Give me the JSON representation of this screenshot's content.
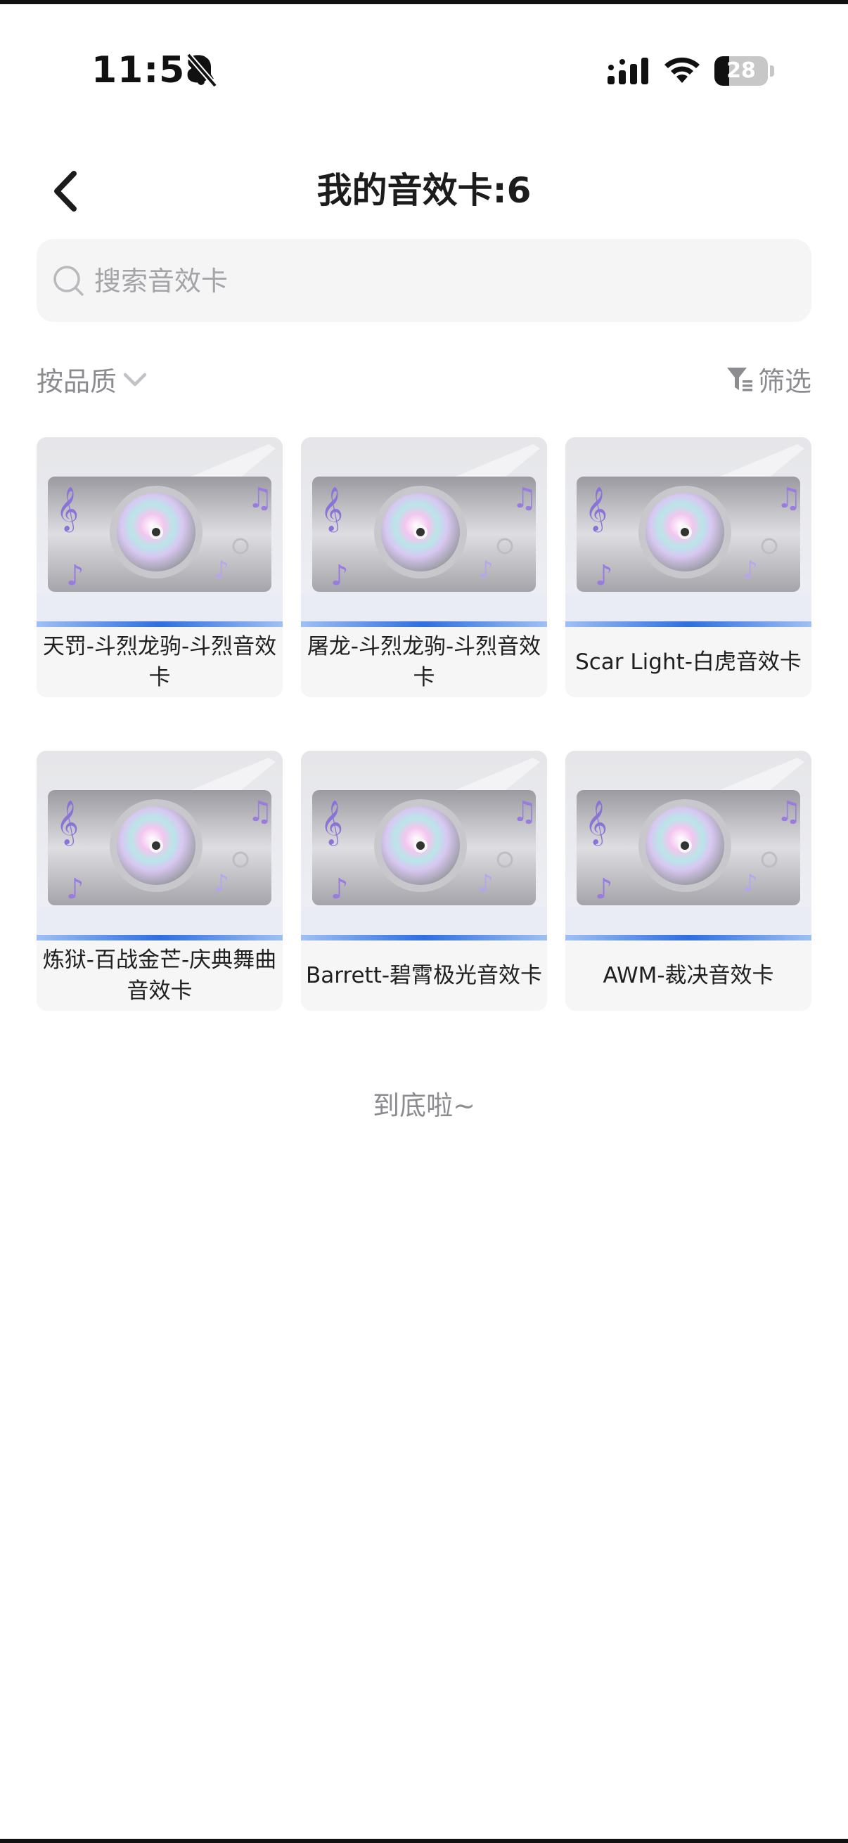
{
  "status_bar": {
    "time": "11:58",
    "battery": "28",
    "battery_level": 0.28
  },
  "header": {
    "title": "我的音效卡:6"
  },
  "search": {
    "placeholder": "搜索音效卡"
  },
  "toolbar": {
    "sort_label": "按品质",
    "filter_label": "筛选"
  },
  "cards": [
    {
      "name": "天罚-斗烈龙驹-斗烈音效卡"
    },
    {
      "name": "屠龙-斗烈龙驹-斗烈音效卡"
    },
    {
      "name": "Scar Light-白虎音效卡"
    },
    {
      "name": "炼狱-百战金芒-庆典舞曲音效卡"
    },
    {
      "name": "Barrett-碧霄极光音效卡"
    },
    {
      "name": "AWM-裁决音效卡"
    }
  ],
  "footer": {
    "end_text": "到底啦~"
  },
  "colors": {
    "accent_blue": "#3f7fe6",
    "note_purple": "#9a7be0"
  }
}
